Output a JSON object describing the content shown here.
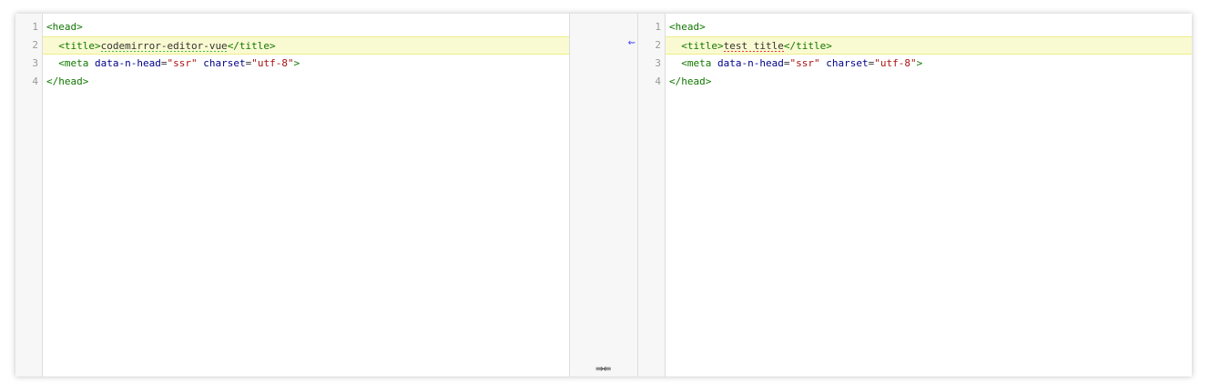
{
  "left": {
    "line_numbers": [
      "1",
      "2",
      "3",
      "4"
    ],
    "lines": {
      "l1": {
        "tag_open": "<head>"
      },
      "l2": {
        "indent": "  ",
        "tag_open": "<title>",
        "text": "codemirror-editor-vue",
        "tag_close": "</title>"
      },
      "l3": {
        "indent": "  ",
        "tag_open": "<meta",
        "attr1": " data-n-head",
        "eq1": "=",
        "val1": "\"ssr\"",
        "attr2": " charset",
        "eq2": "=",
        "val2": "\"utf-8\"",
        "tag_end": ">"
      },
      "l4": {
        "tag_close": "</head>"
      }
    }
  },
  "right": {
    "line_numbers": [
      "1",
      "2",
      "3",
      "4"
    ],
    "lines": {
      "l1": {
        "tag_open": "<head>"
      },
      "l2": {
        "indent": "  ",
        "tag_open": "<title>",
        "text": "test title",
        "tag_close": "</title>"
      },
      "l3": {
        "indent": "  ",
        "tag_open": "<meta",
        "attr1": " data-n-head",
        "eq1": "=",
        "val1": "\"ssr\"",
        "attr2": " charset",
        "eq2": "=",
        "val2": "\"utf-8\"",
        "tag_end": ">"
      },
      "l4": {
        "tag_close": "</head>"
      }
    }
  },
  "middle": {
    "revert_arrow": "⇜",
    "collapse_toggle": "⇛⇚"
  },
  "colors": {
    "tag": "#117700",
    "attribute": "#000088",
    "string": "#aa1111",
    "changed_background": "#fafad2",
    "insert_underline": "#44bb44",
    "delete_underline": "#ee3333"
  }
}
